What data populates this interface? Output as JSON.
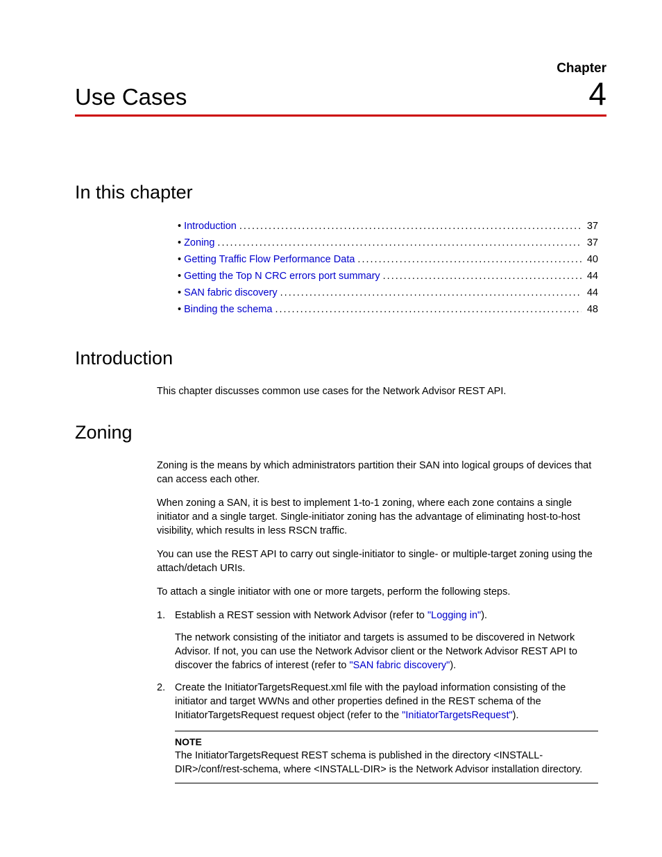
{
  "chapter": {
    "label": "Chapter",
    "number": "4",
    "title": "Use Cases"
  },
  "sections": {
    "in_this_chapter": "In this chapter",
    "introduction_heading": "Introduction",
    "zoning_heading": "Zoning"
  },
  "toc": [
    {
      "label": "Introduction",
      "page": "37"
    },
    {
      "label": "Zoning",
      "page": "37"
    },
    {
      "label": "Getting Traffic Flow Performance Data",
      "page": "40"
    },
    {
      "label": "Getting the Top N CRC errors port summary",
      "page": "44"
    },
    {
      "label": "SAN fabric discovery",
      "page": "44"
    },
    {
      "label": "Binding the schema",
      "page": "48"
    }
  ],
  "introduction": {
    "p1": "This chapter discusses common use cases for the Network Advisor REST API."
  },
  "zoning": {
    "p1": "Zoning is the means by which administrators partition their SAN into logical groups of devices that can access each other.",
    "p2": "When zoning a SAN, it is best to implement 1-to-1 zoning, where each zone contains a single initiator and a single target. Single-initiator zoning has the advantage of eliminating host-to-host visibility, which results in less RSCN traffic.",
    "p3": "You can use the REST API to carry out single-initiator to single- or multiple-target zoning using the attach/detach URIs.",
    "p4": "To attach a single initiator with one or more targets, perform the following steps.",
    "step1_num": "1.",
    "step1_a": "Establish a REST session with Network Advisor (refer to ",
    "step1_link": "\"Logging in\"",
    "step1_b": ").",
    "step1_sub_a": "The network consisting of the initiator and targets is assumed to be discovered in Network Advisor. If not, you can use the Network Advisor client or the Network Advisor REST API to discover the fabrics of interest (refer to ",
    "step1_sub_link": "\"SAN fabric discovery\"",
    "step1_sub_b": ").",
    "step2_num": "2.",
    "step2_a": "Create the InitiatorTargetsRequest.xml file with the payload information consisting of the initiator and target WWNs and other properties defined in the REST schema of the InitiatorTargetsRequest request object (refer to the ",
    "step2_link": "\"InitiatorTargetsRequest\"",
    "step2_b": ").",
    "note_label": "NOTE",
    "note_body": "The InitiatorTargetsRequest REST schema is published in the directory <INSTALL-DIR>/conf/rest-schema, where <INSTALL-DIR> is the Network Advisor installation directory."
  }
}
